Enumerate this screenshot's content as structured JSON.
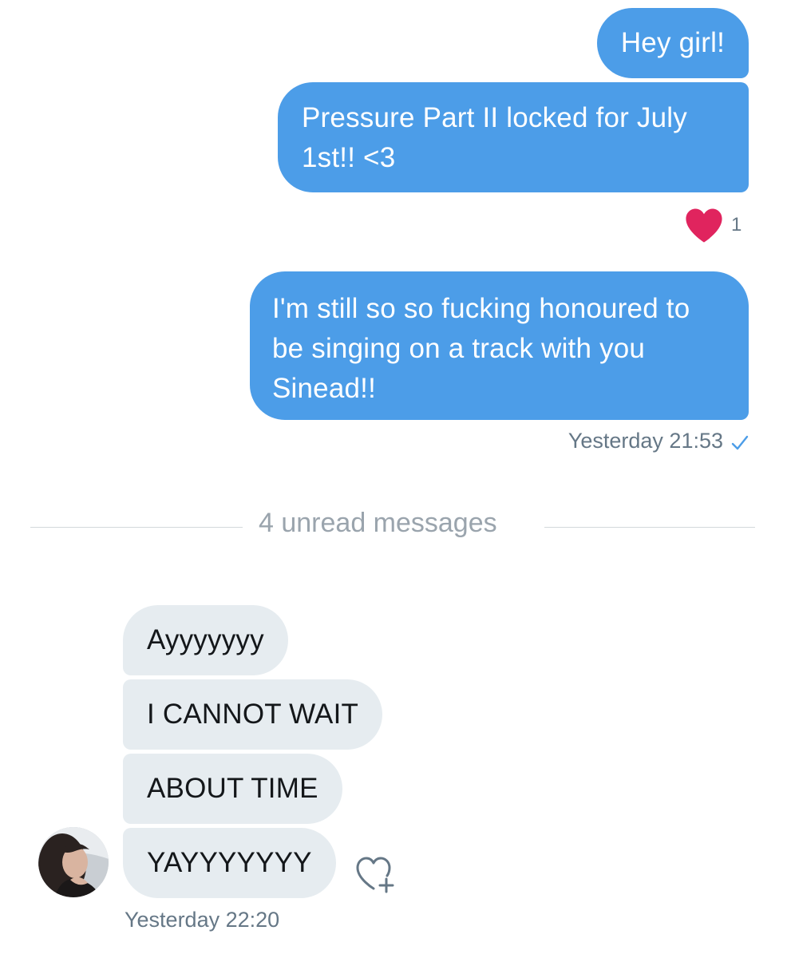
{
  "conversation": {
    "outgoing": [
      {
        "text": "Hey girl!"
      },
      {
        "text": "Pressure Part II locked for July 1st!! <3"
      },
      {
        "text": "I'm still so so fucking honoured to be singing on a track with you Sinead!!"
      }
    ],
    "reaction": {
      "icon": "heart-icon",
      "count": "1",
      "color": "#e0245e"
    },
    "outgoing_timestamp": "Yesterday 21:53",
    "read_receipt_icon": "checkmark-icon",
    "unread_divider": "4 unread messages",
    "incoming": [
      {
        "text": "Ayyyyyyy"
      },
      {
        "text": "I CANNOT WAIT"
      },
      {
        "text": "ABOUT TIME"
      },
      {
        "text": "YAYYYYYYY"
      }
    ],
    "incoming_timestamp": "Yesterday 22:20",
    "like_button_icon": "heart-plus-icon"
  },
  "colors": {
    "outgoing_bubble": "#4c9de8",
    "incoming_bubble": "#e6ecf0",
    "meta_text": "#657786"
  }
}
